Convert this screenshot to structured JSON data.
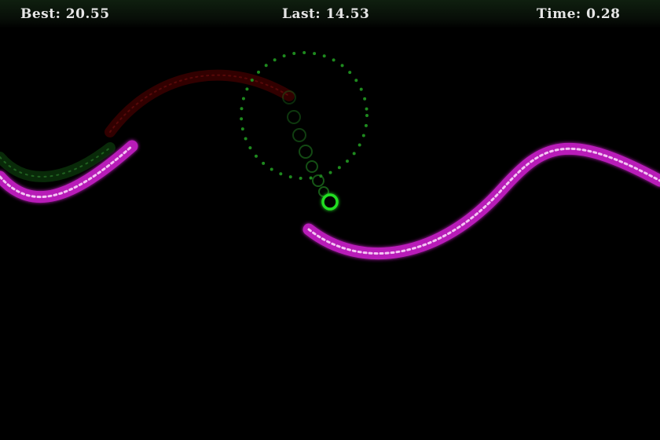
{
  "hud": {
    "best": "Best: 20.55",
    "last": "Last: 14.53",
    "time": "Time: 0.28"
  },
  "colors": {
    "track": "#c020c0",
    "track_bead": "#f0c0f0",
    "fading_trail": "#8b0000",
    "player_trail": "#2e8b2e",
    "player": "#22dd22",
    "orbit_dots": "#1e8a1e",
    "background": "#000000"
  },
  "icons": {
    "player": "ring-icon",
    "orbit": "dotted-circle-icon"
  }
}
